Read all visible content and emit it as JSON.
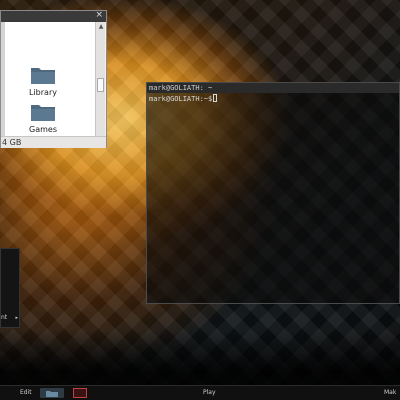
{
  "file_manager": {
    "close_glyph": "×",
    "folders": [
      {
        "label": "Library",
        "icon": "folder-icon"
      },
      {
        "label": "Games",
        "icon": "folder-icon"
      },
      {
        "label": "",
        "icon": "folder-icon"
      }
    ],
    "status": "4 GB"
  },
  "terminal": {
    "title": "mark@GOLIATH: ~",
    "prompt": "mark@GOLIATH:~$"
  },
  "mini_panel": {
    "label": "nt",
    "arrow": "▸"
  },
  "taskbar": {
    "edit_label": "Edit",
    "play_label": "Play",
    "right_label": "Mak"
  },
  "colors": {
    "folder": "#4f6a7f",
    "terminal_button_border": "#c04040"
  }
}
